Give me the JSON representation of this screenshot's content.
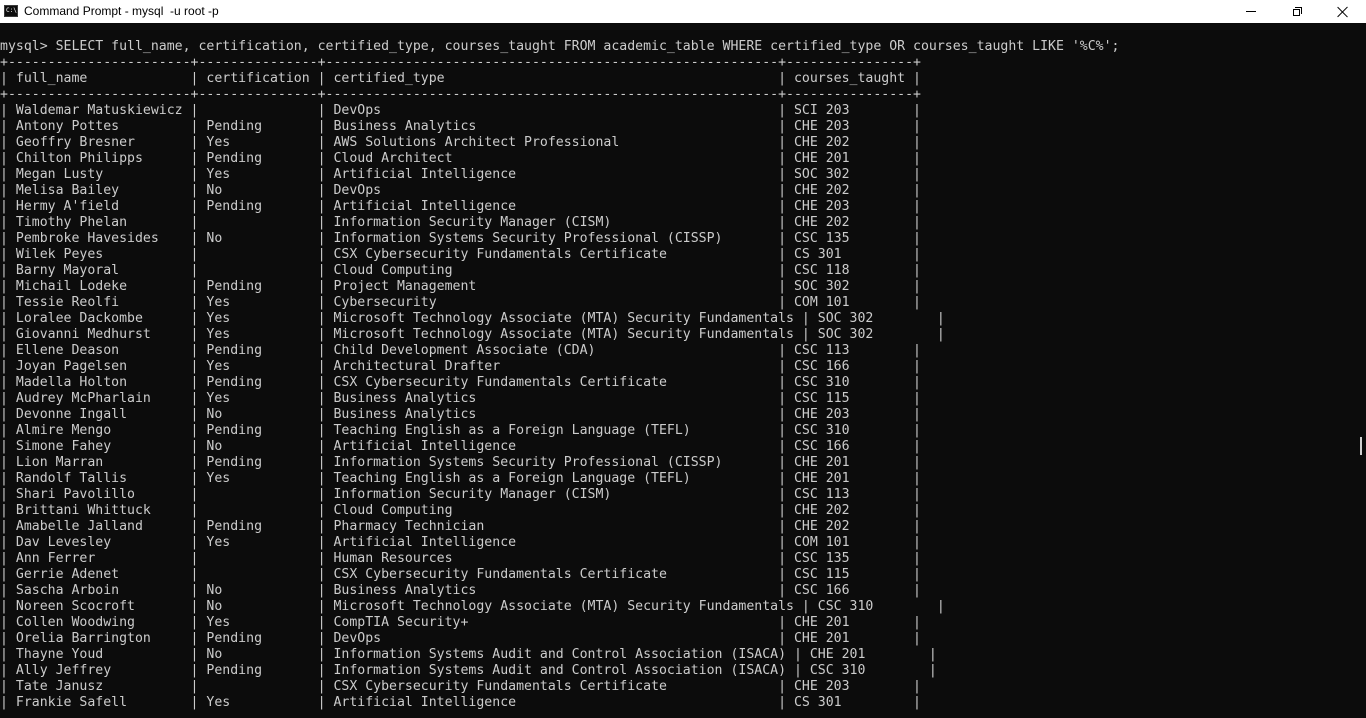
{
  "window": {
    "title": "Command Prompt - mysql  -u root -p",
    "icon": "cmd-icon"
  },
  "console": {
    "lines": [
      "mysql> SELECT full_name, certification, certified_type, courses_taught FROM academic_table WHERE certified_type OR courses_taught LIKE '%C%';",
      "+-----------------------+---------------+---------------------------------------------------------+----------------+",
      "| full_name             | certification | certified_type                                          | courses_taught |",
      "+-----------------------+---------------+---------------------------------------------------------+----------------+",
      "| Waldemar Matuskiewicz |               | DevOps                                                  | SCI 203        |",
      "| Antony Pottes         | Pending       | Business Analytics                                      | CHE 203        |",
      "| Geoffry Bresner       | Yes           | AWS Solutions Architect Professional                    | CHE 202        |",
      "| Chilton Philipps      | Pending       | Cloud Architect                                         | CHE 201        |",
      "| Megan Lusty           | Yes           | Artificial Intelligence                                 | SOC 302        |",
      "| Melisa Bailey         | No            | DevOps                                                  | CHE 202        |",
      "| Hermy A'field         | Pending       | Artificial Intelligence                                 | CHE 203        |",
      "| Timothy Phelan        |               | Information Security Manager (CISM)                     | CHE 202        |",
      "| Pembroke Havesides    | No            | Information Systems Security Professional (CISSP)       | CSC 135        |",
      "| Wilek Peyes           |               | CSX Cybersecurity Fundamentals Certificate              | CS 301         |",
      "| Barny Mayoral         |               | Cloud Computing                                         | CSC 118        |",
      "| Michail Lodeke        | Pending       | Project Management                                      | SOC 302        |",
      "| Tessie Reolfi         | Yes           | Cybersecurity                                           | COM 101        |",
      "| Loralee Dackombe      | Yes           | Microsoft Technology Associate (MTA) Security Fundamentals | SOC 302        |",
      "| Giovanni Medhurst     | Yes           | Microsoft Technology Associate (MTA) Security Fundamentals | SOC 302        |",
      "| Ellene Deason         | Pending       | Child Development Associate (CDA)                       | CSC 113        |",
      "| Joyan Pagelsen        | Yes           | Architectural Drafter                                   | CSC 166        |",
      "| Madella Holton        | Pending       | CSX Cybersecurity Fundamentals Certificate              | CSC 310        |",
      "| Audrey McPharlain     | Yes           | Business Analytics                                      | CSC 115        |",
      "| Devonne Ingall        | No            | Business Analytics                                      | CHE 203        |",
      "| Almire Mengo          | Pending       | Teaching English as a Foreign Language (TEFL)           | CSC 310        |",
      "| Simone Fahey          | No            | Artificial Intelligence                                 | CSC 166        |",
      "| Lion Marran           | Pending       | Information Systems Security Professional (CISSP)       | CHE 201        |",
      "| Randolf Tallis        | Yes           | Teaching English as a Foreign Language (TEFL)           | CHE 201        |",
      "| Shari Pavolillo       |               | Information Security Manager (CISM)                     | CSC 113        |",
      "| Brittani Whittuck     |               | Cloud Computing                                         | CHE 202        |",
      "| Amabelle Jalland      | Pending       | Pharmacy Technician                                     | CHE 202        |",
      "| Dav Levesley          | Yes           | Artificial Intelligence                                 | COM 101        |",
      "| Ann Ferrer            |               | Human Resources                                         | CSC 135        |",
      "| Gerrie Adenet         |               | CSX Cybersecurity Fundamentals Certificate              | CSC 115        |",
      "| Sascha Arboin         | No            | Business Analytics                                      | CSC 166        |",
      "| Noreen Scocroft       | No            | Microsoft Technology Associate (MTA) Security Fundamentals | CSC 310        |",
      "| Collen Woodwing       | Yes           | CompTIA Security+                                       | CHE 201        |",
      "| Orelia Barrington     | Pending       | DevOps                                                  | CHE 201        |",
      "| Thayne Youd           | No            | Information Systems Audit and Control Association (ISACA) | CHE 201        |",
      "| Ally Jeffrey          | Pending       | Information Systems Audit and Control Association (ISACA) | CSC 310        |",
      "| Tate Janusz           |               | CSX Cybersecurity Fundamentals Certificate              | CHE 203        |",
      "| Frankie Safell        | Yes           | Artificial Intelligence                                 | CS 301         |"
    ]
  }
}
